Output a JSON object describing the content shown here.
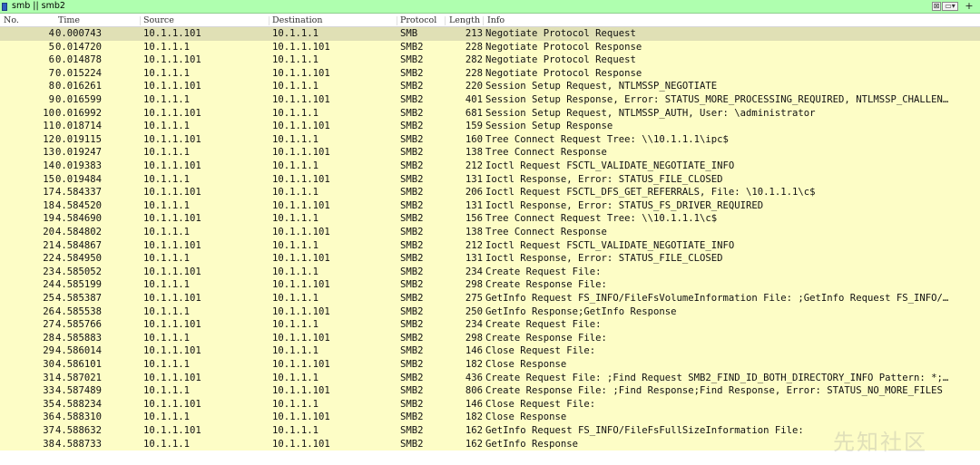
{
  "filter": {
    "expression": "smb || smb2",
    "clear_glyph": "⊠",
    "recent_glyph": "▭▾",
    "add_glyph": "+"
  },
  "columns": [
    "No.",
    "Time",
    "Source",
    "Destination",
    "Protocol",
    "Length",
    "Info"
  ],
  "packets": [
    {
      "no": "4",
      "time": "0.000743",
      "src": "10.1.1.101",
      "dst": "10.1.1.1",
      "proto": "SMB",
      "len": "213",
      "info": "Negotiate Protocol Request"
    },
    {
      "no": "5",
      "time": "0.014720",
      "src": "10.1.1.1",
      "dst": "10.1.1.101",
      "proto": "SMB2",
      "len": "228",
      "info": "Negotiate Protocol Response"
    },
    {
      "no": "6",
      "time": "0.014878",
      "src": "10.1.1.101",
      "dst": "10.1.1.1",
      "proto": "SMB2",
      "len": "282",
      "info": "Negotiate Protocol Request"
    },
    {
      "no": "7",
      "time": "0.015224",
      "src": "10.1.1.1",
      "dst": "10.1.1.101",
      "proto": "SMB2",
      "len": "228",
      "info": "Negotiate Protocol Response"
    },
    {
      "no": "8",
      "time": "0.016261",
      "src": "10.1.1.101",
      "dst": "10.1.1.1",
      "proto": "SMB2",
      "len": "220",
      "info": "Session Setup Request, NTLMSSP_NEGOTIATE"
    },
    {
      "no": "9",
      "time": "0.016599",
      "src": "10.1.1.1",
      "dst": "10.1.1.101",
      "proto": "SMB2",
      "len": "401",
      "info": "Session Setup Response, Error: STATUS_MORE_PROCESSING_REQUIRED, NTLMSSP_CHALLEN…"
    },
    {
      "no": "10",
      "time": "0.016992",
      "src": "10.1.1.101",
      "dst": "10.1.1.1",
      "proto": "SMB2",
      "len": "681",
      "info": "Session Setup Request, NTLMSSP_AUTH, User: \\administrator"
    },
    {
      "no": "11",
      "time": "0.018714",
      "src": "10.1.1.1",
      "dst": "10.1.1.101",
      "proto": "SMB2",
      "len": "159",
      "info": "Session Setup Response"
    },
    {
      "no": "12",
      "time": "0.019115",
      "src": "10.1.1.101",
      "dst": "10.1.1.1",
      "proto": "SMB2",
      "len": "160",
      "info": "Tree Connect Request Tree: \\\\10.1.1.1\\ipc$"
    },
    {
      "no": "13",
      "time": "0.019247",
      "src": "10.1.1.1",
      "dst": "10.1.1.101",
      "proto": "SMB2",
      "len": "138",
      "info": "Tree Connect Response"
    },
    {
      "no": "14",
      "time": "0.019383",
      "src": "10.1.1.101",
      "dst": "10.1.1.1",
      "proto": "SMB2",
      "len": "212",
      "info": "Ioctl Request FSCTL_VALIDATE_NEGOTIATE_INFO"
    },
    {
      "no": "15",
      "time": "0.019484",
      "src": "10.1.1.1",
      "dst": "10.1.1.101",
      "proto": "SMB2",
      "len": "131",
      "info": "Ioctl Response, Error: STATUS_FILE_CLOSED"
    },
    {
      "no": "17",
      "time": "4.584337",
      "src": "10.1.1.101",
      "dst": "10.1.1.1",
      "proto": "SMB2",
      "len": "206",
      "info": "Ioctl Request FSCTL_DFS_GET_REFERRALS, File: \\10.1.1.1\\c$"
    },
    {
      "no": "18",
      "time": "4.584520",
      "src": "10.1.1.1",
      "dst": "10.1.1.101",
      "proto": "SMB2",
      "len": "131",
      "info": "Ioctl Response, Error: STATUS_FS_DRIVER_REQUIRED"
    },
    {
      "no": "19",
      "time": "4.584690",
      "src": "10.1.1.101",
      "dst": "10.1.1.1",
      "proto": "SMB2",
      "len": "156",
      "info": "Tree Connect Request Tree: \\\\10.1.1.1\\c$"
    },
    {
      "no": "20",
      "time": "4.584802",
      "src": "10.1.1.1",
      "dst": "10.1.1.101",
      "proto": "SMB2",
      "len": "138",
      "info": "Tree Connect Response"
    },
    {
      "no": "21",
      "time": "4.584867",
      "src": "10.1.1.101",
      "dst": "10.1.1.1",
      "proto": "SMB2",
      "len": "212",
      "info": "Ioctl Request FSCTL_VALIDATE_NEGOTIATE_INFO"
    },
    {
      "no": "22",
      "time": "4.584950",
      "src": "10.1.1.1",
      "dst": "10.1.1.101",
      "proto": "SMB2",
      "len": "131",
      "info": "Ioctl Response, Error: STATUS_FILE_CLOSED"
    },
    {
      "no": "23",
      "time": "4.585052",
      "src": "10.1.1.101",
      "dst": "10.1.1.1",
      "proto": "SMB2",
      "len": "234",
      "info": "Create Request File:"
    },
    {
      "no": "24",
      "time": "4.585199",
      "src": "10.1.1.1",
      "dst": "10.1.1.101",
      "proto": "SMB2",
      "len": "298",
      "info": "Create Response File:"
    },
    {
      "no": "25",
      "time": "4.585387",
      "src": "10.1.1.101",
      "dst": "10.1.1.1",
      "proto": "SMB2",
      "len": "275",
      "info": "GetInfo Request FS_INFO/FileFsVolumeInformation File: ;GetInfo Request FS_INFO/…"
    },
    {
      "no": "26",
      "time": "4.585538",
      "src": "10.1.1.1",
      "dst": "10.1.1.101",
      "proto": "SMB2",
      "len": "250",
      "info": "GetInfo Response;GetInfo Response"
    },
    {
      "no": "27",
      "time": "4.585766",
      "src": "10.1.1.101",
      "dst": "10.1.1.1",
      "proto": "SMB2",
      "len": "234",
      "info": "Create Request File:"
    },
    {
      "no": "28",
      "time": "4.585883",
      "src": "10.1.1.1",
      "dst": "10.1.1.101",
      "proto": "SMB2",
      "len": "298",
      "info": "Create Response File:"
    },
    {
      "no": "29",
      "time": "4.586014",
      "src": "10.1.1.101",
      "dst": "10.1.1.1",
      "proto": "SMB2",
      "len": "146",
      "info": "Close Request File:"
    },
    {
      "no": "30",
      "time": "4.586101",
      "src": "10.1.1.1",
      "dst": "10.1.1.101",
      "proto": "SMB2",
      "len": "182",
      "info": "Close Response"
    },
    {
      "no": "31",
      "time": "4.587021",
      "src": "10.1.1.101",
      "dst": "10.1.1.1",
      "proto": "SMB2",
      "len": "436",
      "info": "Create Request File: ;Find Request SMB2_FIND_ID_BOTH_DIRECTORY_INFO Pattern: *;…"
    },
    {
      "no": "33",
      "time": "4.587489",
      "src": "10.1.1.1",
      "dst": "10.1.1.101",
      "proto": "SMB2",
      "len": "806",
      "info": "Create Response File: ;Find Response;Find Response, Error: STATUS_NO_MORE_FILES"
    },
    {
      "no": "35",
      "time": "4.588234",
      "src": "10.1.1.101",
      "dst": "10.1.1.1",
      "proto": "SMB2",
      "len": "146",
      "info": "Close Request File:"
    },
    {
      "no": "36",
      "time": "4.588310",
      "src": "10.1.1.1",
      "dst": "10.1.1.101",
      "proto": "SMB2",
      "len": "182",
      "info": "Close Response"
    },
    {
      "no": "37",
      "time": "4.588632",
      "src": "10.1.1.101",
      "dst": "10.1.1.1",
      "proto": "SMB2",
      "len": "162",
      "info": "GetInfo Request FS_INFO/FileFsFullSizeInformation File:"
    },
    {
      "no": "38",
      "time": "4.588733",
      "src": "10.1.1.1",
      "dst": "10.1.1.101",
      "proto": "SMB2",
      "len": "162",
      "info": "GetInfo Response"
    }
  ],
  "selected_packet": "4",
  "watermark": "先知社区",
  "colors": {
    "filter_valid_bg": "#afffaf",
    "row_bg_smb": "#fdfdc6",
    "row_selected_bg": "#e0e0b5"
  }
}
